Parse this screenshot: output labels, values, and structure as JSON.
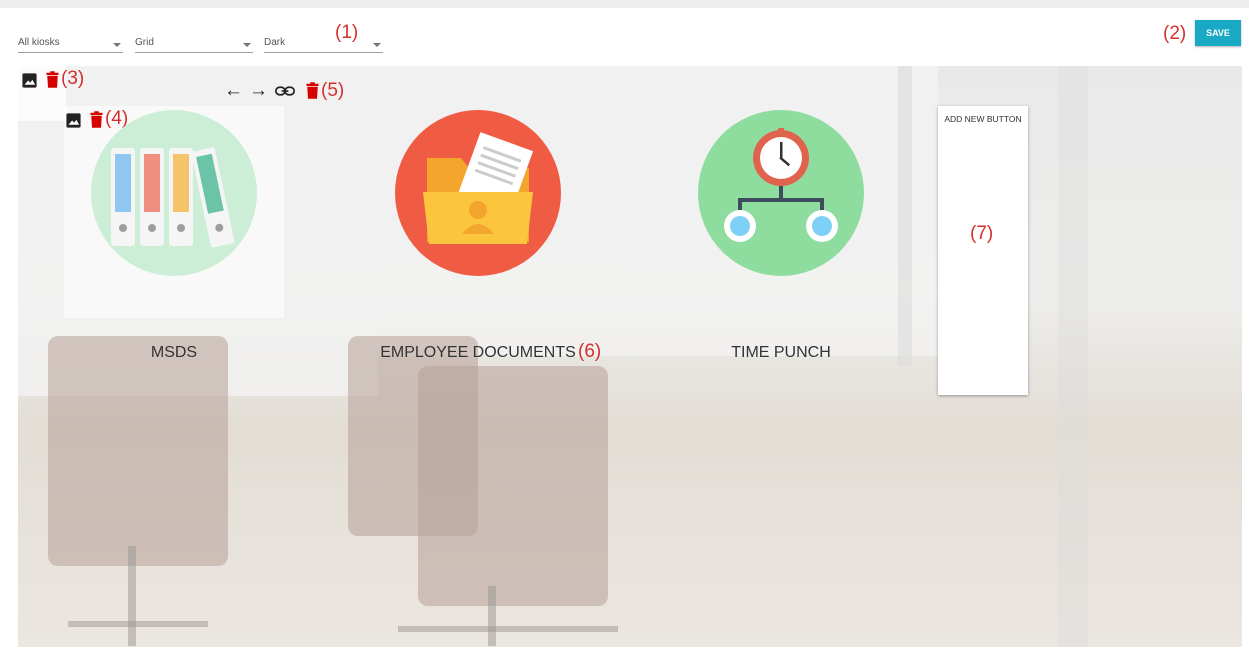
{
  "toolbar": {
    "kiosk_select": "All kiosks",
    "layout_select": "Grid",
    "theme_select": "Dark",
    "save_label": "SAVE"
  },
  "annotations": {
    "a1": "(1)",
    "a2": "(2)",
    "a3": "(3)",
    "a4": "(4)",
    "a5": "(5)",
    "a6": "(6)",
    "a7": "(7)"
  },
  "tiles": [
    {
      "label": "MSDS",
      "icon": "binders-icon",
      "circle_color": "#cdeed6"
    },
    {
      "label": "EMPLOYEE DOCUMENTS",
      "icon": "employee-folder-icon",
      "circle_color": "#f05b44"
    },
    {
      "label": "TIME PUNCH",
      "icon": "clock-org-chart-icon",
      "circle_color": "#8fdc9f"
    }
  ],
  "add_new_button": {
    "label": "ADD NEW BUTTON"
  },
  "colors": {
    "save": "#19a9c5",
    "annotation": "#d32f2f",
    "trash": "#d50000"
  }
}
